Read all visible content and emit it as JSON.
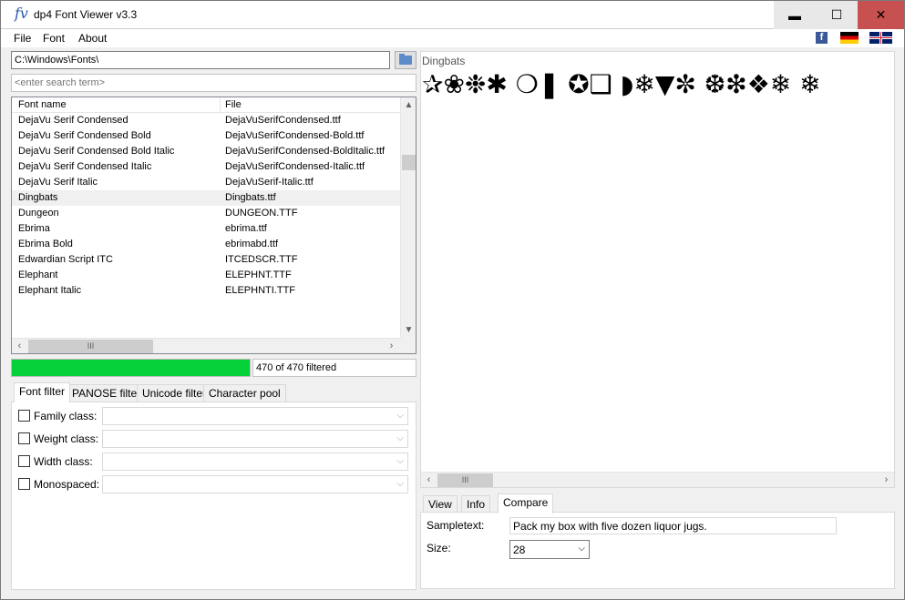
{
  "window": {
    "title": "dp4 Font Viewer v3.3",
    "app_icon": "fv",
    "min_glyph": "▬",
    "max_glyph": "☐",
    "close_glyph": "✕"
  },
  "menu": {
    "file": "File",
    "font": "Font",
    "about": "About"
  },
  "social": {
    "facebook": "f"
  },
  "path": {
    "value": "C:\\Windows\\Fonts\\"
  },
  "search": {
    "placeholder": "<enter search term>"
  },
  "list": {
    "col_name": "Font name",
    "col_file": "File",
    "rows": [
      {
        "name": "DejaVu Serif Condensed",
        "file": "DejaVuSerifCondensed.ttf"
      },
      {
        "name": "DejaVu Serif Condensed Bold",
        "file": "DejaVuSerifCondensed-Bold.ttf"
      },
      {
        "name": "DejaVu Serif Condensed Bold Italic",
        "file": "DejaVuSerifCondensed-BoldItalic.ttf"
      },
      {
        "name": "DejaVu Serif Condensed Italic",
        "file": "DejaVuSerifCondensed-Italic.ttf"
      },
      {
        "name": "DejaVu Serif Italic",
        "file": "DejaVuSerif-Italic.ttf"
      },
      {
        "name": "Dingbats",
        "file": "Dingbats.ttf"
      },
      {
        "name": "Dungeon",
        "file": "DUNGEON.TTF"
      },
      {
        "name": "Ebrima",
        "file": "ebrima.ttf"
      },
      {
        "name": "Ebrima Bold",
        "file": "ebrimabd.ttf"
      },
      {
        "name": "Edwardian Script ITC",
        "file": "ITCEDSCR.TTF"
      },
      {
        "name": "Elephant",
        "file": "ELEPHNT.TTF"
      },
      {
        "name": "Elephant Italic",
        "file": "ELEPHNTI.TTF"
      }
    ],
    "selected_index": 5
  },
  "progress": {
    "fraction": 1.0,
    "color": "#06d13a"
  },
  "filter_count": "470 of 470 filtered",
  "filter_tabs": [
    "Font filter",
    "PANOSE filter",
    "Unicode filter",
    "Character pool"
  ],
  "filters": {
    "family": "Family class:",
    "weight": "Weight class:",
    "width": "Width class:",
    "mono": "Monospaced:"
  },
  "preview": {
    "font_name": "Dingbats",
    "glyphs": "✰❀❉✱ ❍❚ ✪❑ ◗❄▼✼ ❆❇❖❄ ❄"
  },
  "bottom_tabs": [
    "View",
    "Info",
    "Compare"
  ],
  "compare": {
    "sample_label": "Sampletext:",
    "sample_value": "Pack my box with five dozen liquor jugs.",
    "size_label": "Size:",
    "size_value": "28"
  }
}
